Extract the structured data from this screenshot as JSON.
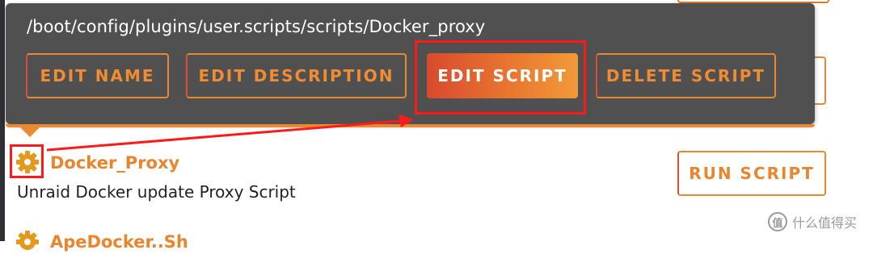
{
  "popup": {
    "path": "/boot/config/plugins/user.scripts/scripts/Docker_proxy",
    "buttons": {
      "edit_name": "EDIT NAME",
      "edit_description": "EDIT DESCRIPTION",
      "edit_script": "EDIT SCRIPT",
      "delete_script": "DELETE SCRIPT"
    }
  },
  "script_row": {
    "icon": "gear-icon",
    "name": "Docker_Proxy",
    "description": "Unraid Docker update Proxy Script",
    "run_label": "RUN SCRIPT"
  },
  "next_row": {
    "icon": "gear-icon",
    "name_partial": "ApeDocker..Sh"
  },
  "watermark": {
    "logo_text": "值",
    "text": "什么值得买"
  },
  "colors": {
    "accent": "#e8852d",
    "accent_red": "#d84a2e",
    "popup_bg": "#505050",
    "highlight": "#ff1a1a"
  }
}
